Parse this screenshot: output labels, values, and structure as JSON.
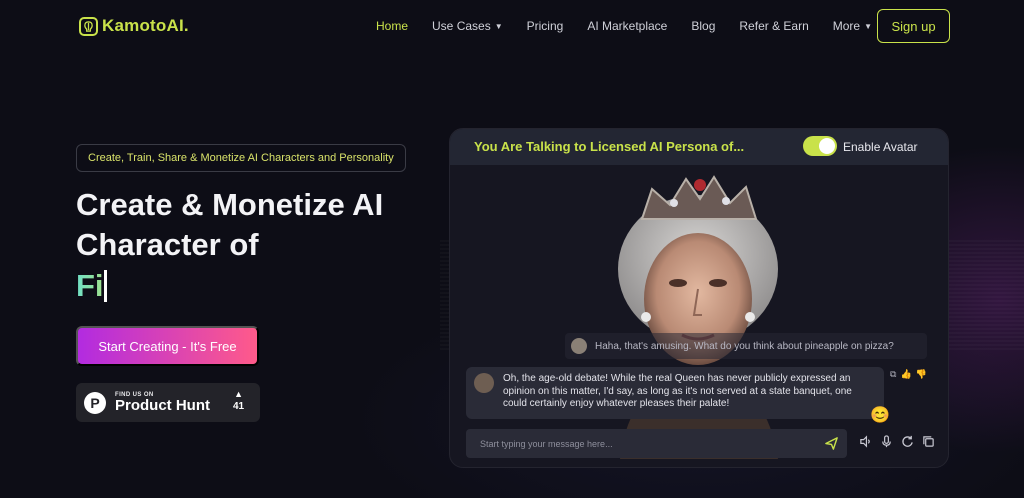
{
  "nav": {
    "logo_text": "KamotoAI.",
    "links": [
      {
        "label": "Home",
        "active": true,
        "dropdown": false
      },
      {
        "label": "Use Cases",
        "active": false,
        "dropdown": true
      },
      {
        "label": "Pricing",
        "active": false,
        "dropdown": false
      },
      {
        "label": "AI Marketplace",
        "active": false,
        "dropdown": false
      },
      {
        "label": "Blog",
        "active": false,
        "dropdown": false
      },
      {
        "label": "Refer & Earn",
        "active": false,
        "dropdown": false
      },
      {
        "label": "More",
        "active": false,
        "dropdown": true
      }
    ],
    "signup_label": "Sign up"
  },
  "hero": {
    "tagline": "Create, Train, Share & Monetize AI Characters and Personality",
    "headline_line1": "Create & Monetize AI",
    "headline_line2": "Character of",
    "typed_text": "Fi",
    "cta_label": "Start Creating - It's Free",
    "product_hunt": {
      "small": "FIND US ON",
      "big": "Product Hunt",
      "votes": "41"
    }
  },
  "chat": {
    "title": "You Are Talking to Licensed AI Persona of...",
    "toggle_label": "Enable Avatar",
    "toggle_on": true,
    "user_message": "Haha, that's amusing. What do you think about pineapple on pizza?",
    "bot_message": "Oh, the age-old debate! While the real Queen has never publicly expressed an opinion on this matter, I'd say, as long as it's not served at a state banquet, one could certainly enjoy whatever pleases their palate!",
    "input_placeholder": "Start typing your message here...",
    "emoji": "😊"
  },
  "colors": {
    "accent": "#c9e24a",
    "background": "#0d0d16",
    "cta_start": "#b22be0",
    "cta_end": "#ff5a8a"
  }
}
